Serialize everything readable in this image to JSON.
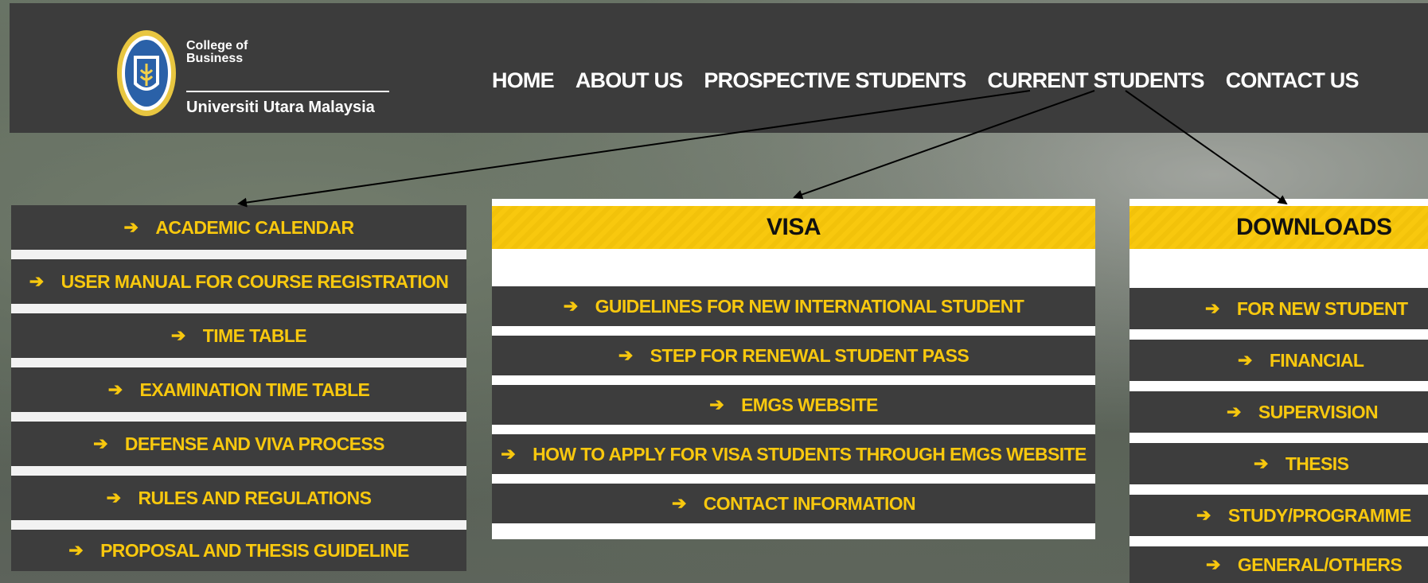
{
  "header": {
    "logo": {
      "college_line1": "College of",
      "college_line2": "Business",
      "university": "Universiti Utara Malaysia"
    },
    "nav": [
      "HOME",
      "ABOUT US",
      "PROSPECTIVE STUDENTS",
      "CURRENT STUDENTS",
      "CONTACT US"
    ]
  },
  "academic_links": [
    "ACADEMIC CALENDAR",
    "USER MANUAL FOR COURSE REGISTRATION",
    "TIME TABLE",
    "EXAMINATION TIME TABLE",
    "DEFENSE AND VIVA PROCESS",
    "RULES AND REGULATIONS",
    "PROPOSAL AND THESIS GUIDELINE"
  ],
  "visa": {
    "title": "VISA",
    "links": [
      "GUIDELINES FOR NEW INTERNATIONAL STUDENT",
      "STEP FOR RENEWAL STUDENT PASS",
      "EMGS WEBSITE",
      "HOW TO APPLY FOR VISA STUDENTS THROUGH EMGS WEBSITE",
      "CONTACT INFORMATION"
    ]
  },
  "downloads": {
    "title": "DOWNLOADS",
    "links": [
      "FOR NEW STUDENT",
      "FINANCIAL",
      "SUPERVISION",
      "THESIS",
      "STUDY/PROGRAMME",
      "GENERAL/OTHERS"
    ]
  },
  "colors": {
    "accent": "#f8c80e",
    "panel": "#3d3d3d",
    "header": "#3c3c3c"
  },
  "icons": {
    "link_arrow": "arrow-right-icon"
  }
}
